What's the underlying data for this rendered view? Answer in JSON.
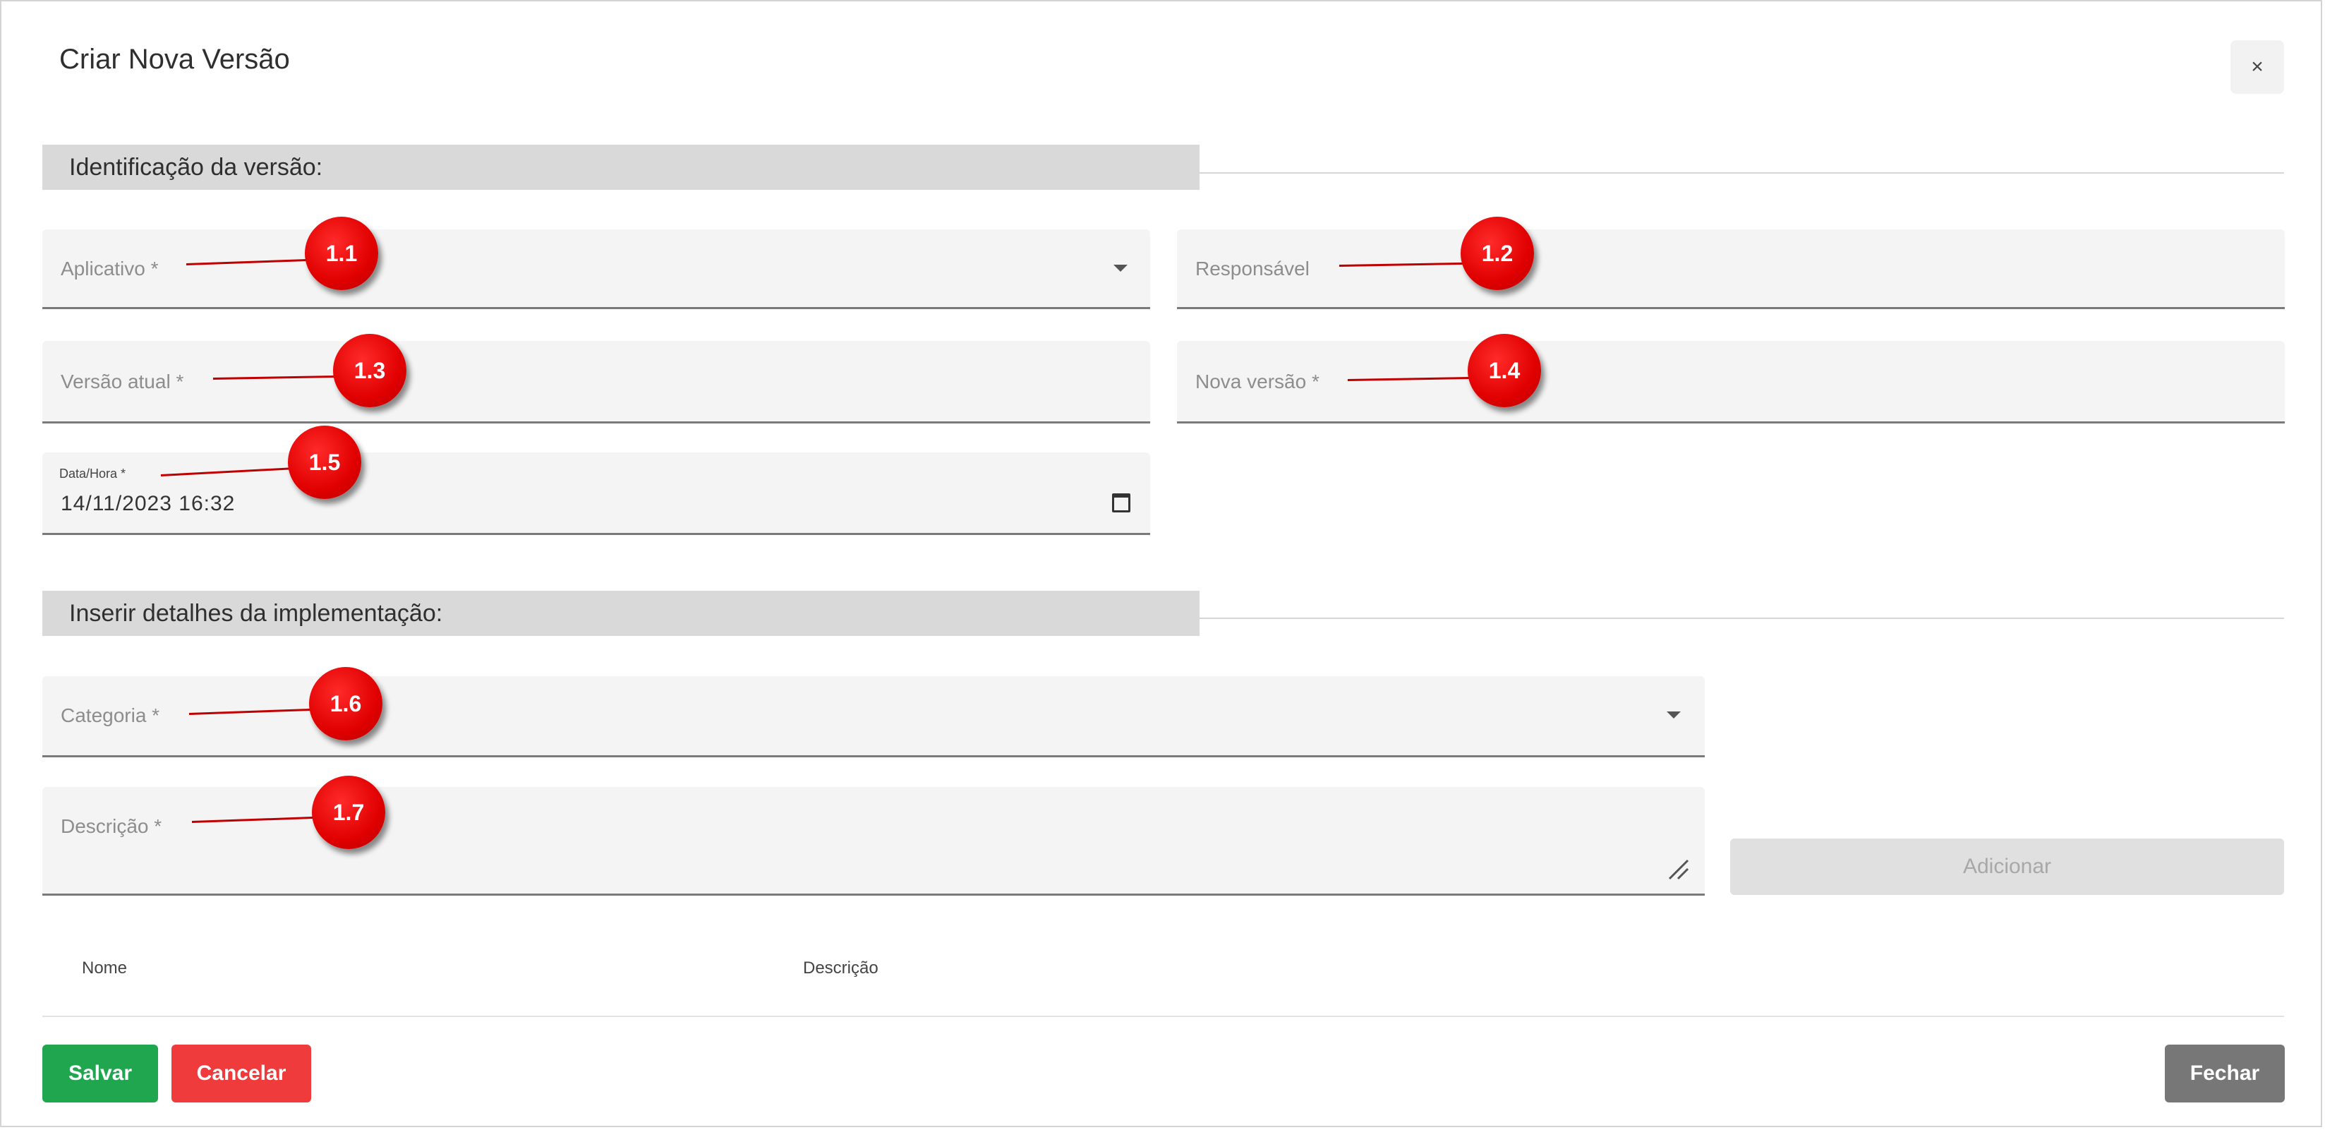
{
  "dialog": {
    "title": "Criar Nova Versão",
    "close_label": "×"
  },
  "section_identification": {
    "label": "Identificação da versão:"
  },
  "fields": {
    "aplicativo": {
      "label": "Aplicativo *"
    },
    "responsavel": {
      "label": "Responsável"
    },
    "versao_atual": {
      "label": "Versão atual *"
    },
    "nova_versao": {
      "label": "Nova versão *"
    },
    "data_hora": {
      "label": "Data/Hora *",
      "value": "14/11/2023 16:32"
    },
    "categoria": {
      "label": "Categoria *"
    },
    "descricao": {
      "label": "Descrição *"
    }
  },
  "section_details": {
    "label": "Inserir detalhes da implementação:"
  },
  "add_button": {
    "label": "Adicionar"
  },
  "table": {
    "columns": [
      "Nome",
      "Descrição"
    ]
  },
  "footer": {
    "save_label": "Salvar",
    "cancel_label": "Cancelar",
    "close_label": "Fechar"
  },
  "callouts": [
    "1.1",
    "1.2",
    "1.3",
    "1.4",
    "1.5",
    "1.6",
    "1.7"
  ],
  "colors": {
    "save": "#1fa64f",
    "cancel": "#ef3b3b",
    "close": "#777777",
    "callout": "#e00000"
  }
}
